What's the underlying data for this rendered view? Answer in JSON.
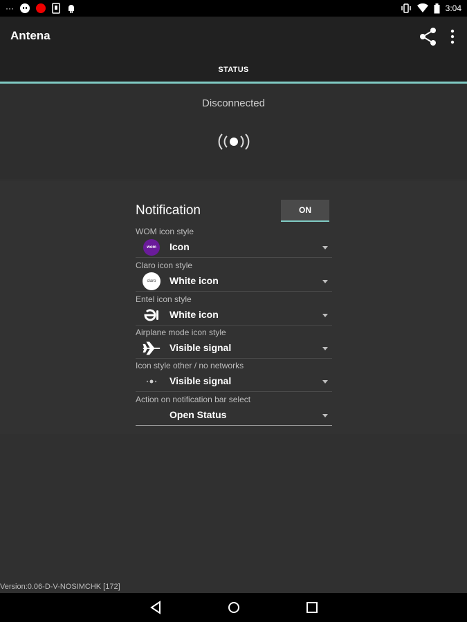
{
  "statusbar": {
    "time": "3:04"
  },
  "appbar": {
    "title": "Antena"
  },
  "tabs": [
    {
      "label": "STATUS"
    }
  ],
  "status": {
    "connection": "Disconnected"
  },
  "notification": {
    "title": "Notification",
    "toggle_label": "ON",
    "rows": [
      {
        "label": "WOM icon style",
        "value": "Icon",
        "icon": "wom-logo-icon",
        "badge": "wom"
      },
      {
        "label": "Claro icon style",
        "value": "White icon",
        "icon": "claro-logo-icon",
        "badge": "claro"
      },
      {
        "label": "Entel icon style",
        "value": "White icon",
        "icon": "entel-logo-icon"
      },
      {
        "label": "Airplane mode icon style",
        "value": "Visible signal",
        "icon": "airplane-icon"
      },
      {
        "label": "Icon style other / no networks",
        "value": "Visible signal",
        "icon": "no-network-icon"
      },
      {
        "label": "Action on notification bar select",
        "value": "Open Status"
      }
    ]
  },
  "footer": {
    "version": "Version:0.06-D-V-NOSIMCHK [172]"
  },
  "colors": {
    "accent": "#80cbc4",
    "appbar": "#212121",
    "background": "#303030"
  }
}
